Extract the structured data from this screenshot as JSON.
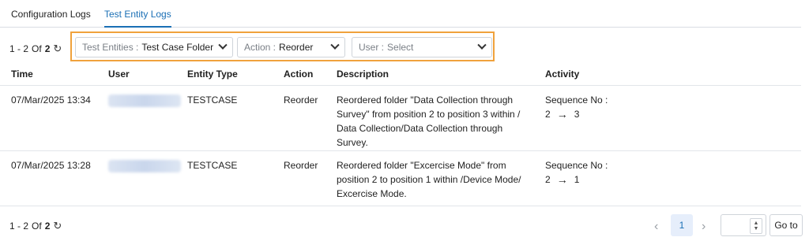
{
  "tabs": [
    "Configuration Logs",
    "Test Entity Logs"
  ],
  "pager": {
    "range": "1 - 2",
    "of_label": "Of",
    "total": "2",
    "refresh_icon": "refresh-icon"
  },
  "filters": {
    "entities": {
      "label": "Test Entities :",
      "value": "Test Case Folder"
    },
    "action": {
      "label": "Action :",
      "value": "Reorder"
    },
    "user": {
      "label": "User :",
      "value": "Select"
    }
  },
  "columns": [
    "Time",
    "User",
    "Entity Type",
    "Action",
    "Description",
    "Activity"
  ],
  "rows": [
    {
      "time": "07/Mar/2025 13:34",
      "entity_type": "TESTCASE",
      "action": "Reorder",
      "description": "Reordered folder \"Data Collection through Survey\" from position 2 to position 3 within / Data Collection/Data Collection through Survey.",
      "activity": {
        "label": "Sequence No :",
        "from": "2",
        "to": "3"
      }
    },
    {
      "time": "07/Mar/2025 13:28",
      "entity_type": "TESTCASE",
      "action": "Reorder",
      "description": "Reordered folder \"Excercise Mode\" from position 2 to position 1 within /Device Mode/ Excercise Mode.",
      "activity": {
        "label": "Sequence No :",
        "from": "2",
        "to": "1"
      }
    }
  ],
  "pagination": {
    "current_page": "1",
    "goto_label": "Go to",
    "page_input_value": ""
  },
  "colors": {
    "accent": "#1a6fb5",
    "highlight_border": "#f0a23c"
  }
}
